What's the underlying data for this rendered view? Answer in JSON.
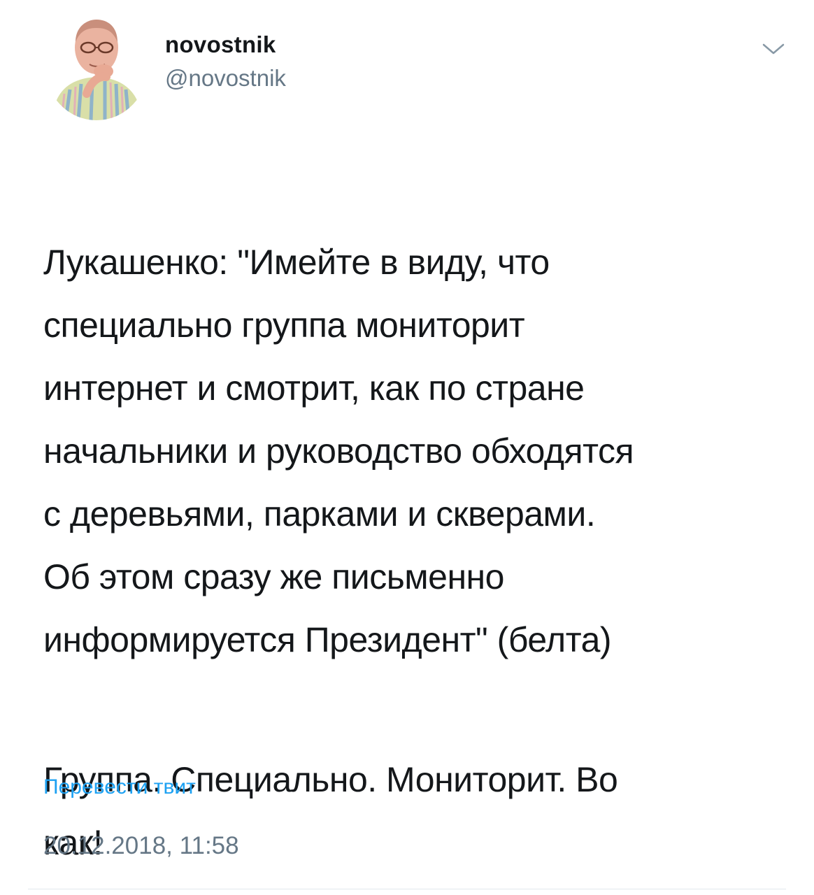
{
  "user": {
    "display_name": "novostnik",
    "handle": "@novostnik"
  },
  "tweet": {
    "paragraph1": "Лукашенко: \"Имейте в виду, что\nспециально группа мониторит\nинтернет и смотрит, как по стране\nначальники и руководство обходятся\nс деревьями, парками и скверами.\nОб этом сразу же письменно\nинформируется Президент\" (белта)",
    "paragraph2": "Группа. Специально. Мониторит. Во\nкак!",
    "translate_label": "Перевести твит",
    "timestamp": "20.12.2018, 11:58"
  },
  "icons": {
    "menu": "chevron-down-icon",
    "avatar": "avatar"
  },
  "colors": {
    "link": "#1da1f2",
    "secondary_text": "#657786",
    "primary_text": "#14171a",
    "divider": "#e1e8ed"
  }
}
